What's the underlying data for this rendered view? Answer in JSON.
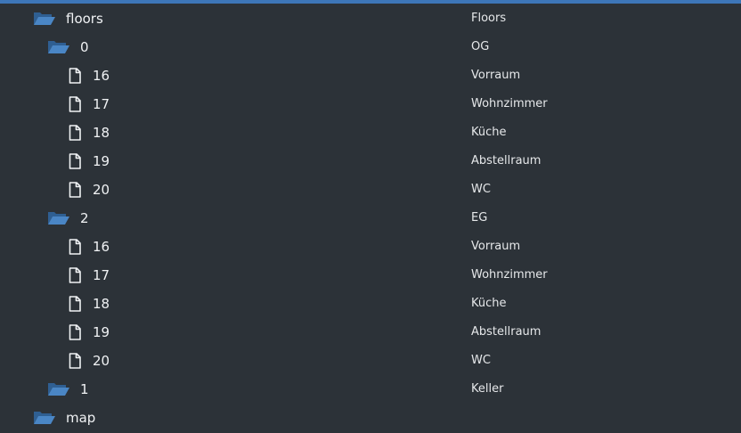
{
  "accent_color": "#3d76b8",
  "folder_icon": "folder-open-icon",
  "file_icon": "file-icon",
  "tree": {
    "floors": {
      "label": "floors",
      "desc": "Floors",
      "children": [
        {
          "label": "0",
          "desc": "OG",
          "children": [
            {
              "label": "16",
              "desc": "Vorraum"
            },
            {
              "label": "17",
              "desc": "Wohnzimmer"
            },
            {
              "label": "18",
              "desc": "Küche"
            },
            {
              "label": "19",
              "desc": "Abstellraum"
            },
            {
              "label": "20",
              "desc": "WC"
            }
          ]
        },
        {
          "label": "2",
          "desc": "EG",
          "children": [
            {
              "label": "16",
              "desc": "Vorraum"
            },
            {
              "label": "17",
              "desc": "Wohnzimmer"
            },
            {
              "label": "18",
              "desc": "Küche"
            },
            {
              "label": "19",
              "desc": "Abstellraum"
            },
            {
              "label": "20",
              "desc": "WC"
            }
          ]
        },
        {
          "label": "1",
          "desc": "Keller"
        }
      ]
    },
    "map": {
      "label": "map"
    }
  }
}
